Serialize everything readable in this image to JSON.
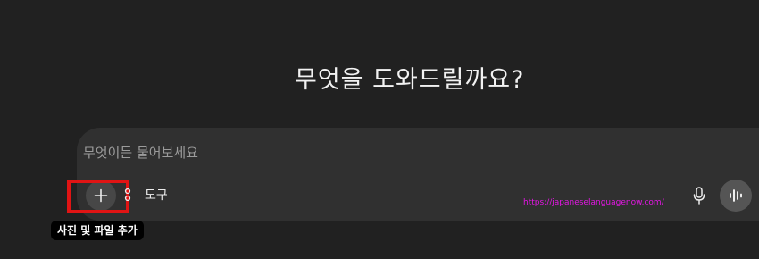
{
  "headline": "무엇을 도와드릴까요?",
  "composer": {
    "placeholder": "무엇이든 물어보세요",
    "tools_label": "도구"
  },
  "tooltip": {
    "add_label": "사진 및 파일 추가"
  },
  "watermark": "https://japaneselanguagenow.com/",
  "icons": {
    "add": "plus-icon",
    "tools": "tools-icon",
    "mic": "microphone-icon",
    "voice": "voice-waveform-icon"
  },
  "colors": {
    "background": "#212121",
    "composer": "#303030",
    "highlight": "#e01414",
    "watermark": "#e316e3"
  }
}
